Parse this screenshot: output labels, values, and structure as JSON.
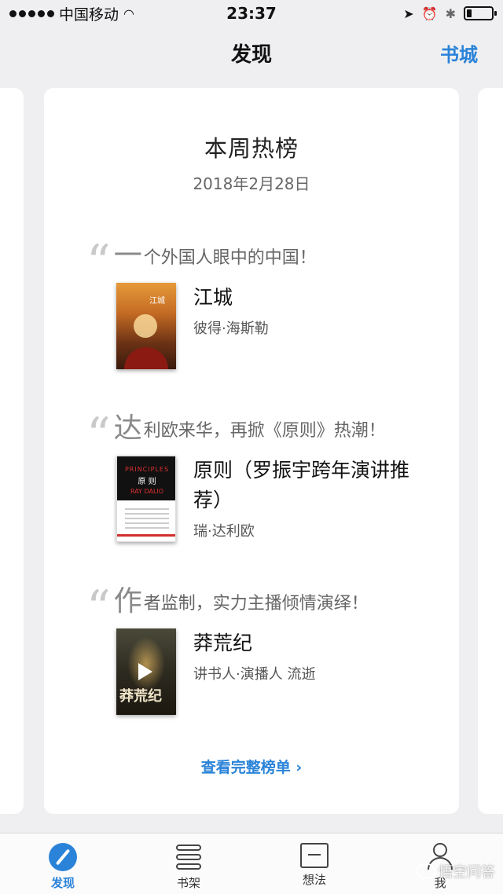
{
  "status_bar": {
    "carrier": "中国移动",
    "time": "23:37",
    "battery_level": 0.2
  },
  "nav": {
    "title": "发现",
    "right_link": "书城"
  },
  "card": {
    "title": "本周热榜",
    "date": "2018年2月28日",
    "sections": [
      {
        "quote_first_char": "一",
        "quote_rest": "个外国人眼中的中国！",
        "book_title": "江城",
        "book_author": "彼得·海斯勒",
        "cover_icon": "jiangcheng-cover"
      },
      {
        "quote_first_char": "达",
        "quote_rest": "利欧来华，再掀《原则》热潮！",
        "book_title": "原则（罗振宇跨年演讲推荐）",
        "book_author": "瑞·达利欧",
        "cover_icon": "principles-cover",
        "cover_text_en": "PRINCIPLES",
        "cover_text_cn": "原 则",
        "cover_text_author": "RAY DALIO"
      },
      {
        "quote_first_char": "作",
        "quote_rest": "者监制，实力主播倾情演绎！",
        "book_title": "莽荒纪",
        "book_author": "讲书人·演播人 流逝",
        "cover_icon": "manghuang-cover",
        "cover_text": "莽荒纪"
      }
    ],
    "view_all": "查看完整榜单 ›"
  },
  "tabs": [
    {
      "label": "发现",
      "icon": "compass-icon",
      "active": true
    },
    {
      "label": "书架",
      "icon": "bookshelf-icon",
      "active": false
    },
    {
      "label": "想法",
      "icon": "idea-icon",
      "active": false
    },
    {
      "label": "我",
      "icon": "profile-icon",
      "active": false
    }
  ],
  "watermark": "悟空问答",
  "colors": {
    "accent": "#2a83d8",
    "background": "#efeff2",
    "card": "#ffffff"
  }
}
